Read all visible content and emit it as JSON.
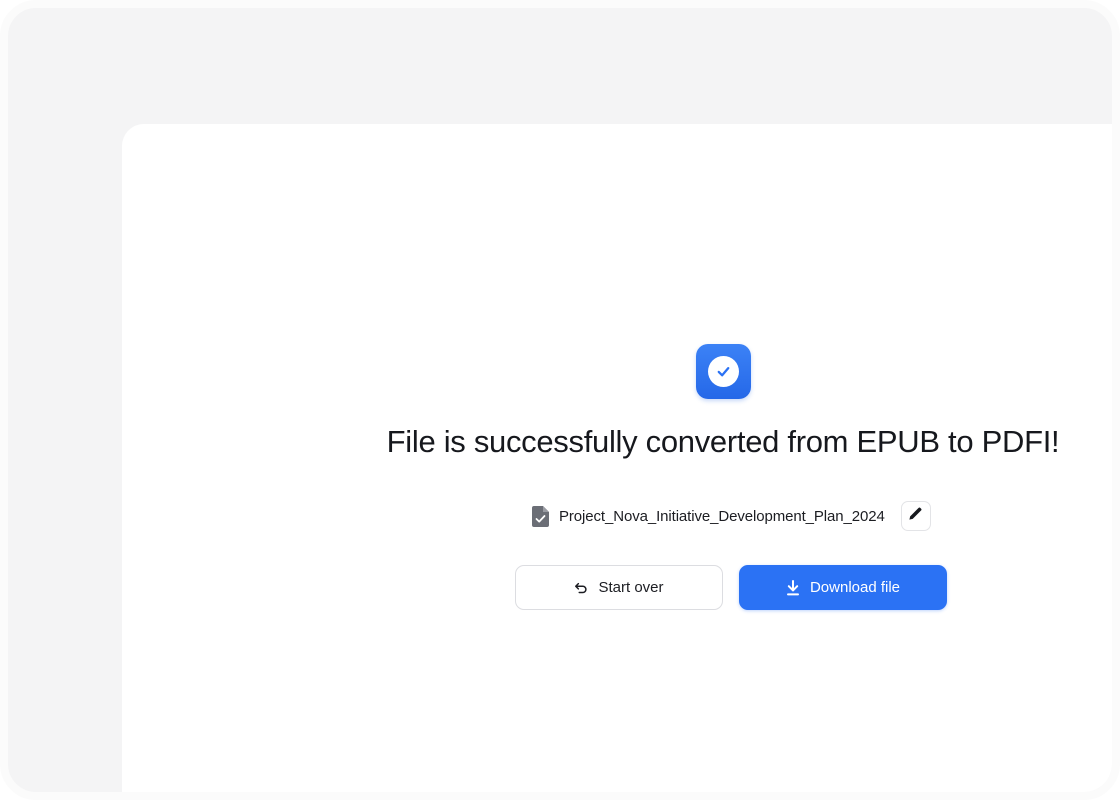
{
  "success": {
    "icon": "check-circle-icon",
    "headline": "File is successfully converted from EPUB to PDFI!"
  },
  "file": {
    "icon": "file-check-icon",
    "name": "Project_Nova_Initiative_Development_Plan_2024",
    "edit_icon": "pencil-icon"
  },
  "actions": {
    "start_over_label": "Start over",
    "start_over_icon": "undo-icon",
    "download_label": "Download file",
    "download_icon": "download-icon"
  },
  "colors": {
    "accent": "#2b72f4",
    "background": "#f4f4f5",
    "card": "#ffffff",
    "text": "#16181d"
  }
}
